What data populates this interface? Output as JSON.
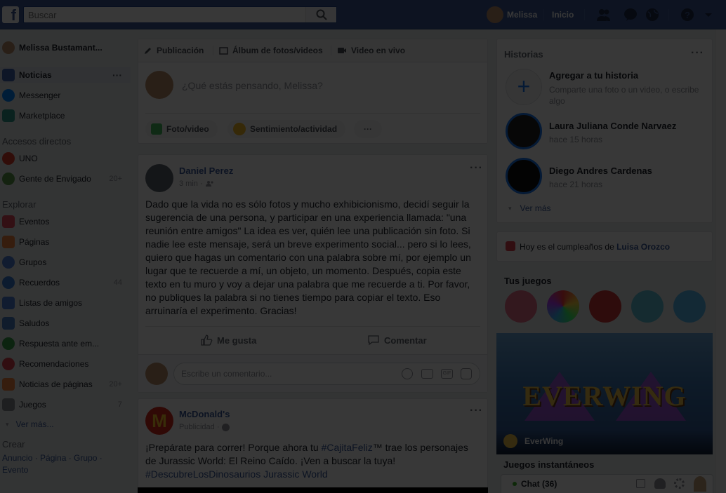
{
  "topbar": {
    "search_placeholder": "Buscar",
    "user_name": "Melissa",
    "home_label": "Inicio"
  },
  "left": {
    "profile_name": "Melissa Bustamant...",
    "nav": [
      {
        "label": "Noticias",
        "icon": "news-feed-icon"
      },
      {
        "label": "Messenger",
        "icon": "messenger-icon"
      },
      {
        "label": "Marketplace",
        "icon": "marketplace-icon"
      }
    ],
    "shortcuts_title": "Accesos directos",
    "shortcuts": [
      {
        "label": "UNO",
        "count": ""
      },
      {
        "label": "Gente de Envigado",
        "count": "20+"
      }
    ],
    "explore_title": "Explorar",
    "explore": [
      {
        "label": "Eventos",
        "count": ""
      },
      {
        "label": "Páginas",
        "count": ""
      },
      {
        "label": "Grupos",
        "count": ""
      },
      {
        "label": "Recuerdos",
        "count": "44"
      },
      {
        "label": "Listas de amigos",
        "count": ""
      },
      {
        "label": "Saludos",
        "count": ""
      },
      {
        "label": "Respuesta ante em...",
        "count": ""
      },
      {
        "label": "Recomendaciones",
        "count": ""
      },
      {
        "label": "Noticias de páginas",
        "count": "20+"
      },
      {
        "label": "Juegos",
        "count": "7"
      }
    ],
    "see_more": "Ver más...",
    "create_title": "Crear",
    "create_links": "Anuncio · Página · Grupo ·",
    "create_links2": "Evento"
  },
  "composer": {
    "tab_post": "Publicación",
    "tab_album": "Álbum de fotos/videos",
    "tab_live": "Video en vivo",
    "placeholder": "¿Qué estás pensando, Melissa?",
    "btn_photo": "Foto/video",
    "btn_feeling": "Sentimiento/actividad",
    "more": "···"
  },
  "post1": {
    "author": "Daniel Perez",
    "time": "3 min ·",
    "text": "Dado que la vida no es sólo fotos y mucho exhibicionismo, decidí seguir la sugerencia de una persona, y participar en una experiencia llamada: \"una reunión entre amigos\" La idea es ver, quién lee una publicación sin foto. Si nadie lee este mensaje, será un breve experimento social... pero si lo lees, quiero que hagas un comentario con una palabra sobre mí, por ejemplo un lugar que te recuerde a mí, un objeto, un momento. Después, copia este texto en tu muro y voy a dejar una palabra que me recuerde a ti. Por favor, no publiques la palabra si no tienes tiempo para copiar el texto. Eso arruinaría el experimento. Gracias!",
    "like": "Me gusta",
    "comment": "Comentar",
    "comment_placeholder": "Escribe un comentario..."
  },
  "post2": {
    "author": "McDonald's",
    "meta": "Publicidad ·",
    "text_a": "¡Prepárate para correr! Porque ahora tu ",
    "hashtag1": "#CajitaFeliz",
    "text_b": "™ trae los personajes de Jurassic World: El Reino Caído. ¡Ven a buscar la tuya!",
    "hashtag2": "#DescubreLosDinosaurios Jurassic World"
  },
  "right": {
    "stories_title": "Historias",
    "add_story_title": "Agregar a tu historia",
    "add_story_sub": "Comparte una foto o un video, o escribe algo",
    "stories": [
      {
        "name": "Laura Juliana Conde Narvaez",
        "time": "hace 15 horas"
      },
      {
        "name": "Diego Andres Cardenas",
        "time": "hace 21 horas"
      }
    ],
    "see_more": "Ver más",
    "birthday_prefix": "Hoy es el cumpleaños de ",
    "birthday_name": "Luisa Orozco",
    "games_title": "Tus juegos",
    "ev_name": "EverWing",
    "ev_logo": "EVERWING",
    "instant_title": "Juegos instantáneos",
    "chat_label": "Chat (36)"
  }
}
